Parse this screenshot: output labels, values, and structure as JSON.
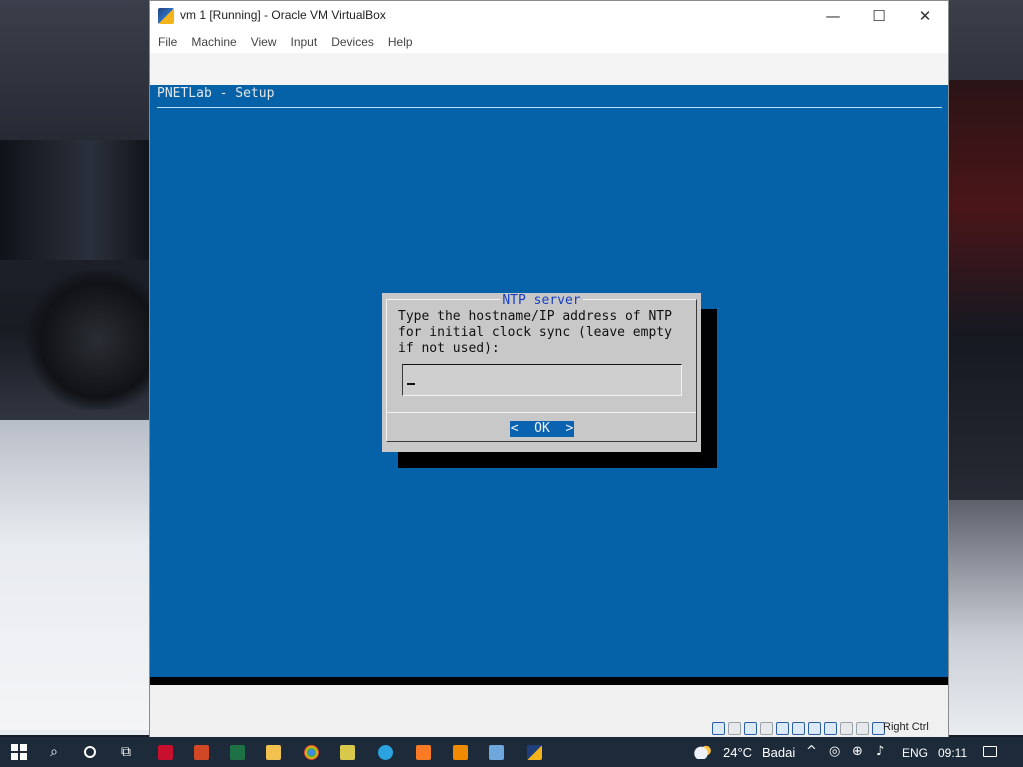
{
  "window": {
    "title": "vm 1 [Running] - Oracle VM VirtualBox",
    "controls": {
      "minimize": "—",
      "maximize": "☐",
      "close": "✕"
    }
  },
  "menu": [
    "File",
    "Machine",
    "View",
    "Input",
    "Devices",
    "Help"
  ],
  "vm": {
    "header": "PNETLab - Setup",
    "dialog": {
      "title": "NTP server",
      "prompt": "Type the hostname/IP address of NTP\nfor initial clock sync (leave empty\nif not used):",
      "input_value": "",
      "ok_label": "<  OK  >"
    }
  },
  "statusbar": {
    "host_key": "Right Ctrl"
  },
  "taskbar": {
    "weather_temp": "24°C",
    "weather_desc": "Badai",
    "language": "ENG",
    "time": "09:11"
  },
  "colors": {
    "vm_background": "#0562a8",
    "dialog_background": "#c8c8c8",
    "dialog_title": "#1b3fbd",
    "ok_button": "#0a63b0",
    "taskbar": "#1c2a3a"
  }
}
